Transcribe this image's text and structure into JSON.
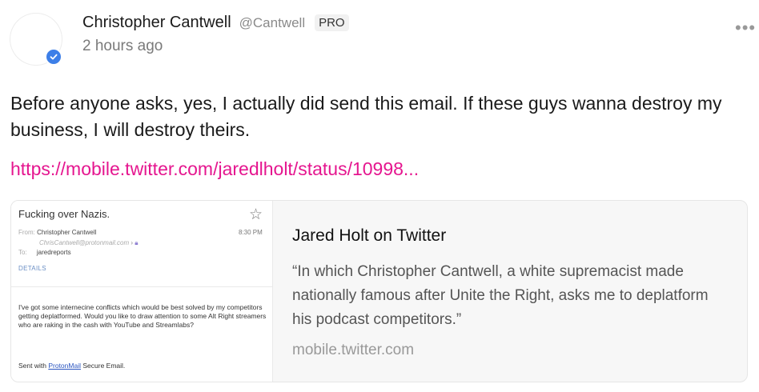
{
  "post": {
    "author_name": "Christopher Cantwell",
    "handle": "@Cantwell",
    "badge": "PRO",
    "timestamp": "2 hours ago",
    "text": "Before anyone asks, yes, I actually did send this email. If these guys wanna destroy my business, I will destroy theirs.",
    "link": "https://mobile.twitter.com/jaredlholt/status/10998...",
    "more_icon": "ellipsis-icon",
    "verified_icon": "check-icon"
  },
  "card": {
    "title": "Jared Holt on Twitter",
    "description": "“In which Christopher Cantwell, a white supremacist made nationally famous after Unite the Right, asks me to deplatform his podcast competitors.”",
    "domain": "mobile.twitter.com",
    "email": {
      "subject": "Fucking over Nazis.",
      "from_label": "From:",
      "from_name": "Christopher Cantwell",
      "from_address": "ChrisCantwell@protonmail.com",
      "time": "8:30 PM",
      "to_label": "To:",
      "to_name": "jaredreports",
      "details_label": "DETAILS",
      "body": "I've got some internecine conflicts which would be best solved by my competitors getting deplatformed. Would you like to draw attention to some Alt Right streamers who are raking in the cash with YouTube and Streamlabs?",
      "footer_prefix": "Sent with",
      "footer_link": "ProtonMail",
      "footer_suffix": "Secure Email."
    }
  },
  "colors": {
    "link": "#e5168f",
    "verified": "#3d7fe8",
    "card_bg": "#f7f7f7"
  }
}
